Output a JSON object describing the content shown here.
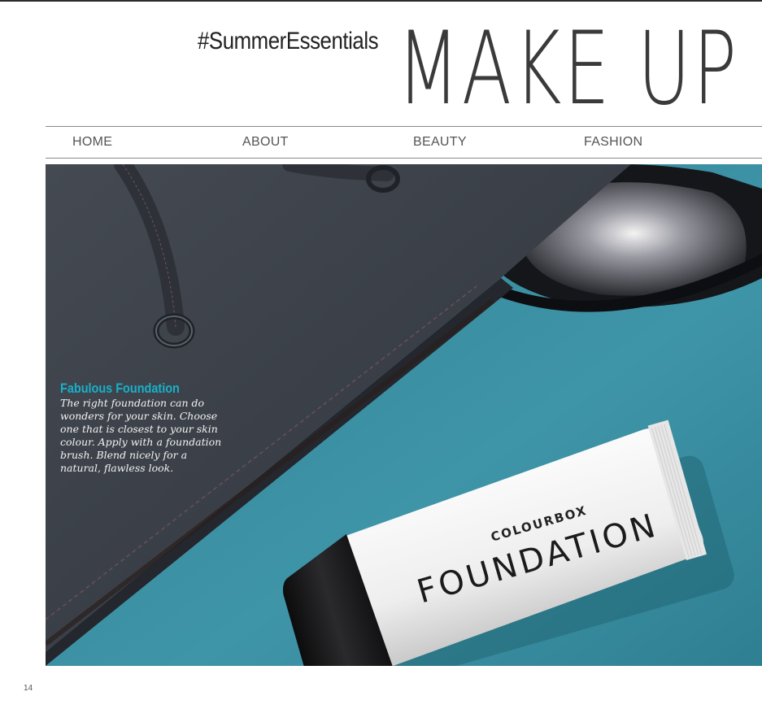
{
  "header": {
    "hashtag": "#SummerEssentials",
    "title": "MAKE UP"
  },
  "nav": {
    "items": [
      "HOME",
      "ABOUT",
      "BEAUTY",
      "FASHION"
    ]
  },
  "feature": {
    "title": "Fabulous Foundation",
    "body": "The right foundation can do wonders for your skin. Choose one that is closest to your skin colour. Apply with a foundation brush. Blend nicely for a natural, flawless look."
  },
  "product": {
    "brand": "COLOURBOX",
    "name": "FOUNDATION"
  },
  "page_number": "14",
  "colors": {
    "accent": "#19b0c9",
    "teal_background": "#3f8b9c",
    "bag": "#3a3f47"
  }
}
